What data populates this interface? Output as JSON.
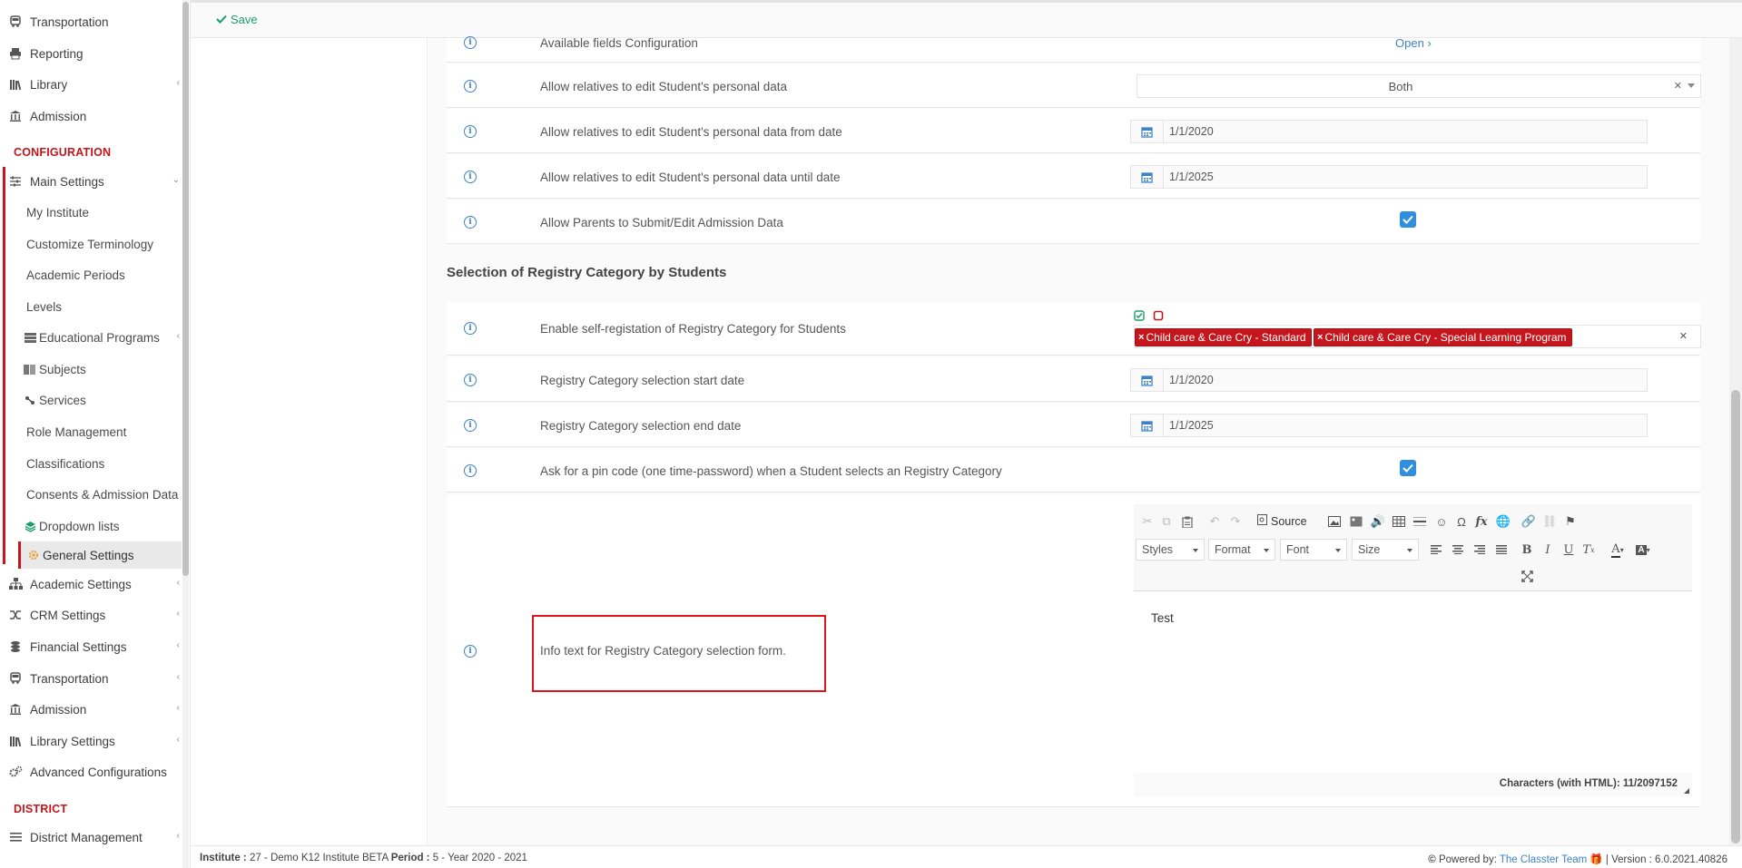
{
  "toolbar": {
    "save_label": "Save"
  },
  "sidebar": {
    "top_items": [
      {
        "label": "Transportation",
        "icon": "bus-icon"
      },
      {
        "label": "Reporting",
        "icon": "printer-icon"
      },
      {
        "label": "Library",
        "icon": "books-icon"
      },
      {
        "label": "Admission",
        "icon": "institution-icon"
      }
    ],
    "section_configuration": "CONFIGURATION",
    "main_settings": "Main Settings",
    "sub_items": [
      {
        "label": "My Institute"
      },
      {
        "label": "Customize Terminology"
      },
      {
        "label": "Academic Periods"
      },
      {
        "label": "Levels"
      },
      {
        "label": "Educational Programs",
        "icon": "program-icon"
      },
      {
        "label": "Subjects",
        "icon": "book-icon"
      },
      {
        "label": "Services",
        "icon": "services-icon"
      },
      {
        "label": "Role Management"
      },
      {
        "label": "Classifications"
      },
      {
        "label": "Consents & Admission Data"
      },
      {
        "label": "Dropdown lists",
        "icon": "layers-icon"
      },
      {
        "label": "General Settings",
        "icon": "cogs-icon",
        "active": true
      }
    ],
    "bottom_items": [
      {
        "label": "Academic Settings",
        "icon": "sitemap-icon"
      },
      {
        "label": "CRM Settings",
        "icon": "shuffle-icon"
      },
      {
        "label": "Financial Settings",
        "icon": "coins-icon"
      },
      {
        "label": "Transportation",
        "icon": "bus-icon"
      },
      {
        "label": "Admission",
        "icon": "institution-icon"
      },
      {
        "label": "Library Settings",
        "icon": "books-icon"
      },
      {
        "label": "Advanced Configurations",
        "icon": "gears-icon"
      }
    ],
    "section_district": "DISTRICT",
    "district_item": {
      "label": "District Management",
      "icon": "list-icon"
    }
  },
  "settings": {
    "available_fields": {
      "label": "Available fields Configuration",
      "link": "Open"
    },
    "allow_edit": {
      "label": "Allow relatives to edit Student's personal data",
      "value": "Both"
    },
    "allow_edit_from": {
      "label": "Allow relatives to edit Student's personal data from date",
      "value": "1/1/2020"
    },
    "allow_edit_until": {
      "label": "Allow relatives to edit Student's personal data until date",
      "value": "1/1/2025"
    },
    "allow_parents": {
      "label": "Allow Parents to Submit/Edit Admission Data",
      "checked": true
    },
    "section_title": "Selection of Registry Category by Students",
    "enable_self_reg": {
      "label": "Enable self-registation of Registry Category for Students",
      "tags": [
        "Child care & Care Cry - Standard",
        "Child care & Care Cry - Special Learning Program"
      ]
    },
    "reg_start": {
      "label": "Registry Category selection start date",
      "value": "1/1/2020"
    },
    "reg_end": {
      "label": "Registry Category selection end date",
      "value": "1/1/2025"
    },
    "pin_code": {
      "label": "Ask for a pin code (one time-password) when a Student selects an Registry Category",
      "checked": true
    },
    "info_text": {
      "label": "Info text for Registry Category selection form."
    }
  },
  "editor": {
    "source_label": "Source",
    "styles_label": "Styles",
    "format_label": "Format",
    "font_label": "Font",
    "size_label": "Size",
    "content": "Test",
    "char_count_label": "Characters (with HTML): ",
    "char_count_value": "11/2097152"
  },
  "footer": {
    "institute_label": "Institute :",
    "institute_value": " 27 - Demo K12 Institute BETA ",
    "period_label": "Period :",
    "period_value": " 5 - Year 2020 - 2021",
    "powered_label": "Powered by: ",
    "powered_link": "The Classter Team",
    "version_label": " | Version : 6.0.2021.40826"
  },
  "colors": {
    "accent": "#3f82c4",
    "brand_red": "#c4161c",
    "save_green": "#1a9e6a",
    "checkbox_blue": "#2f8fdc"
  }
}
